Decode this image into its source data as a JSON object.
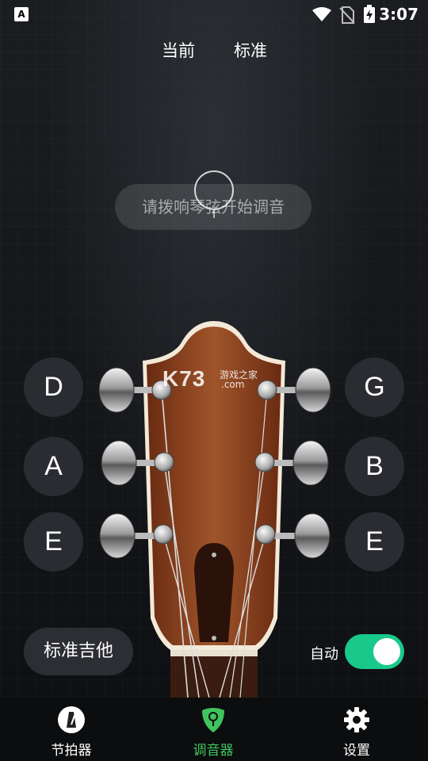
{
  "status_bar": {
    "left_icon": "A",
    "time": "3:07",
    "icons": [
      "wifi-icon",
      "no-sim-icon",
      "battery-charging-icon"
    ]
  },
  "header": {
    "current_label": "当前",
    "standard_label": "标准"
  },
  "prompt": {
    "text": "请拨响琴弦开始调音"
  },
  "strings": {
    "left": [
      "D",
      "A",
      "E"
    ],
    "right": [
      "G",
      "B",
      "E"
    ]
  },
  "watermark": {
    "main": "K73",
    "sub": "游戏之家",
    "domain": ".com"
  },
  "controls": {
    "preset_label": "标准吉他",
    "auto_label": "自动",
    "auto_enabled": true
  },
  "bottom_nav": {
    "items": [
      {
        "label": "节拍器",
        "icon": "metronome-icon",
        "active": false
      },
      {
        "label": "调音器",
        "icon": "tuner-pick-icon",
        "active": true
      },
      {
        "label": "设置",
        "icon": "gear-icon",
        "active": false
      }
    ]
  },
  "colors": {
    "accent": "#19c98c",
    "active_nav": "#3fc45e",
    "button_bg": "#2a2c31"
  }
}
